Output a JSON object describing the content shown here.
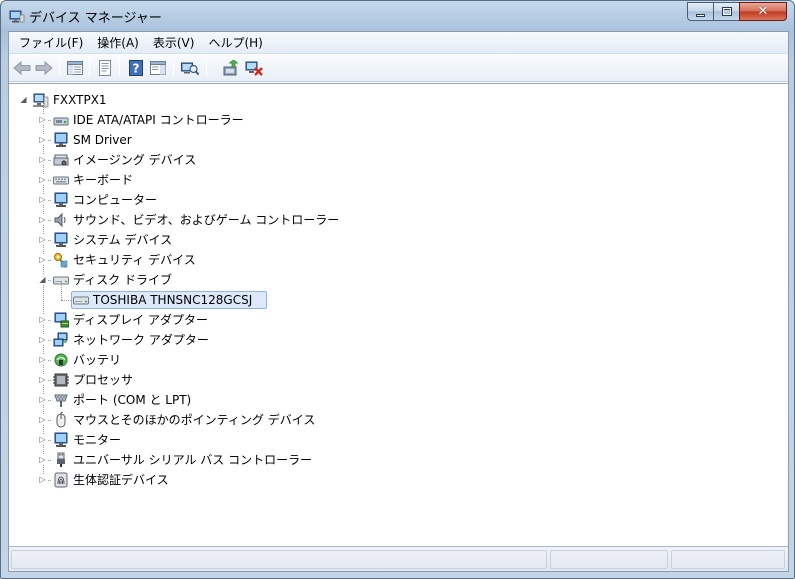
{
  "window": {
    "title": "デバイス マネージャー",
    "accent": "#3a6ea5"
  },
  "menu": [
    {
      "label": "ファイル(F)"
    },
    {
      "label": "操作(A)"
    },
    {
      "label": "表示(V)"
    },
    {
      "label": "ヘルプ(H)"
    }
  ],
  "toolbar": {
    "buttons": [
      {
        "icon": "back-arrow-icon"
      },
      {
        "icon": "forward-arrow-icon"
      },
      {
        "icon": "show-hide-console-tree-icon"
      },
      {
        "icon": "properties-icon"
      },
      {
        "icon": "help-icon"
      },
      {
        "icon": "action-pane-icon"
      },
      {
        "icon": "scan-hardware-icon"
      },
      {
        "icon": "update-driver-icon"
      },
      {
        "icon": "uninstall-icon"
      }
    ]
  },
  "tree": {
    "root": {
      "label": "FXXTPX1",
      "icon": "computer-icon",
      "expanded": true
    },
    "categories": [
      {
        "label": "IDE ATA/ATAPI コントローラー",
        "icon": "ide-controller-icon",
        "expanded": false
      },
      {
        "label": "SM Driver",
        "icon": "monitor-icon",
        "expanded": false
      },
      {
        "label": "イメージング デバイス",
        "icon": "scanner-icon",
        "expanded": false
      },
      {
        "label": "キーボード",
        "icon": "keyboard-icon",
        "expanded": false
      },
      {
        "label": "コンピューター",
        "icon": "monitor-icon",
        "expanded": false
      },
      {
        "label": "サウンド、ビデオ、およびゲーム コントローラー",
        "icon": "speaker-icon",
        "expanded": false
      },
      {
        "label": "システム デバイス",
        "icon": "monitor-icon",
        "expanded": false
      },
      {
        "label": "セキュリティ デバイス",
        "icon": "key-icon",
        "expanded": false
      },
      {
        "label": "ディスク ドライブ",
        "icon": "disk-drive-icon",
        "expanded": true,
        "children": [
          {
            "label": "TOSHIBA THNSNC128GCSJ",
            "icon": "disk-drive-icon",
            "selected": true
          }
        ]
      },
      {
        "label": "ディスプレイ アダプター",
        "icon": "display-adapter-icon",
        "expanded": false
      },
      {
        "label": "ネットワーク アダプター",
        "icon": "network-adapter-icon",
        "expanded": false
      },
      {
        "label": "バッテリ",
        "icon": "battery-icon",
        "expanded": false
      },
      {
        "label": "プロセッサ",
        "icon": "processor-icon",
        "expanded": false
      },
      {
        "label": "ポート (COM と LPT)",
        "icon": "port-icon",
        "expanded": false
      },
      {
        "label": "マウスとそのほかのポインティング デバイス",
        "icon": "mouse-icon",
        "expanded": false
      },
      {
        "label": "モニター",
        "icon": "monitor-icon",
        "expanded": false
      },
      {
        "label": "ユニバーサル シリアル バス コントローラー",
        "icon": "usb-icon",
        "expanded": false
      },
      {
        "label": "生体認証デバイス",
        "icon": "fingerprint-icon",
        "expanded": false
      }
    ]
  },
  "status": {
    "text": ""
  }
}
